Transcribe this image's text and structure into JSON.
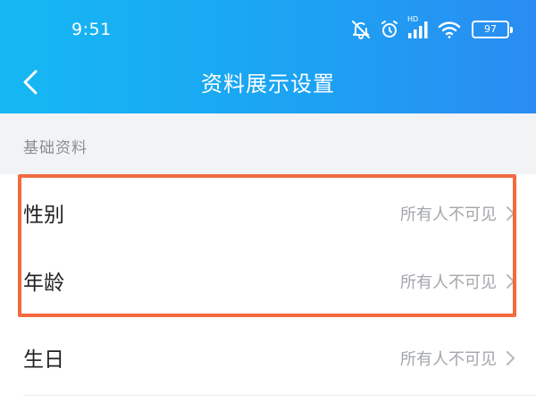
{
  "status_bar": {
    "time": "9:51",
    "network_badge": "HD",
    "battery": "97",
    "icons": [
      "mute-bell-icon",
      "alarm-icon",
      "signal-icon",
      "wifi-icon",
      "battery-icon"
    ]
  },
  "nav": {
    "title": "资料展示设置",
    "back_icon": "chevron-left-icon"
  },
  "section": {
    "label": "基础资料"
  },
  "rows": [
    {
      "label": "性别",
      "value": "所有人不可见"
    },
    {
      "label": "年龄",
      "value": "所有人不可见"
    },
    {
      "label": "生日",
      "value": "所有人不可见"
    }
  ],
  "colors": {
    "header_start": "#15b8f3",
    "header_end": "#2a8cf2",
    "highlight": "#f26b3e",
    "value_text": "#a3a6ab",
    "section_bg": "#f2f3f5"
  }
}
